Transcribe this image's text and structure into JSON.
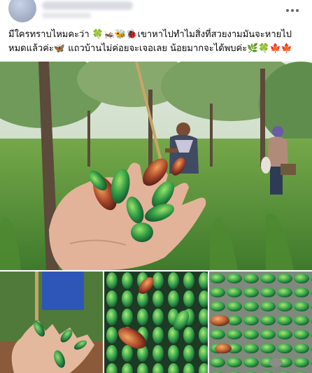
{
  "post": {
    "caption_line1": "มีใครทราบไหมคะว่า 🍀🦗🐝🐞เขาหาไปทำไมสิ่งที่สวยงามมันจะหายไป",
    "caption_line2": "หมดแล้วค่ะ🦋 แถวบ้านไม่ค่อยจะเจอเลย น้อยมากจะได้พบค่ะ🌿🍀🍁🍁"
  },
  "photos": [
    {
      "name": "hand-holding-jewel-beetles-in-forest"
    },
    {
      "name": "hand-with-beetles"
    },
    {
      "name": "beetle-pile"
    },
    {
      "name": "beetle-pile-on-ground"
    }
  ],
  "colors": {
    "beetle_green": "#3aa84a",
    "beetle_copper": "#b5532a",
    "grass": "#5f9a3a",
    "icon_gray": "#65676b"
  }
}
